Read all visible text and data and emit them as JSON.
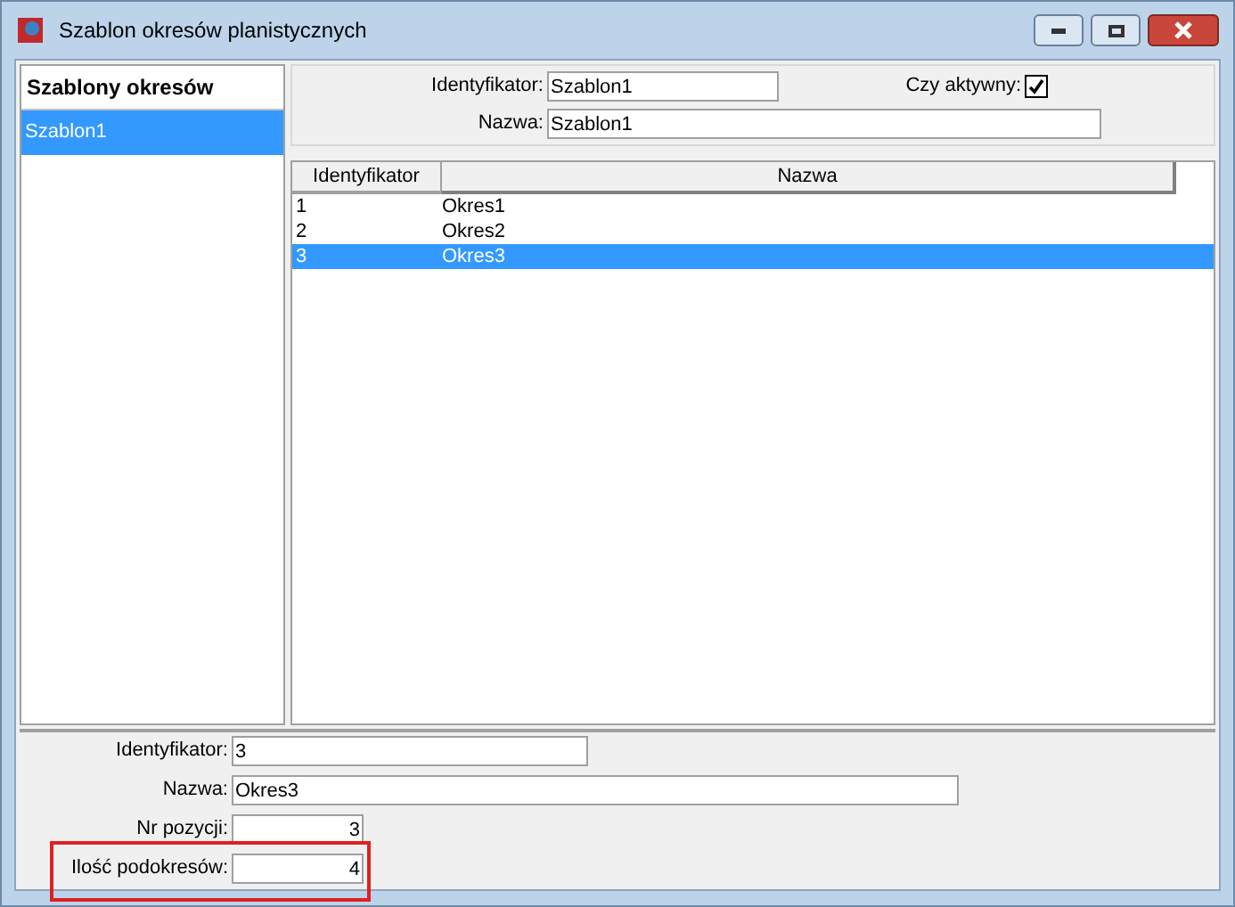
{
  "window": {
    "title": "Szablon okresów planistycznych"
  },
  "sidebar": {
    "title": "Szablony okresów",
    "items": [
      {
        "label": "Szablon1",
        "selected": true
      }
    ]
  },
  "header_form": {
    "id_label": "Identyfikator:",
    "id_value": "Szablon1",
    "active_label": "Czy aktywny:",
    "active_checked": true,
    "name_label": "Nazwa:",
    "name_value": "Szablon1"
  },
  "table": {
    "columns": [
      "Identyfikator",
      "Nazwa"
    ],
    "rows": [
      {
        "cells": [
          "1",
          "Okres1"
        ],
        "selected": false
      },
      {
        "cells": [
          "2",
          "Okres2"
        ],
        "selected": false
      },
      {
        "cells": [
          "3",
          "Okres3"
        ],
        "selected": true
      }
    ]
  },
  "detail_form": {
    "fields": [
      {
        "label": "Identyfikator:",
        "value": "3",
        "kind": "text",
        "highlighted": false
      },
      {
        "label": "Nazwa:",
        "value": "Okres3",
        "kind": "text",
        "highlighted": false
      },
      {
        "label": "Nr pozycji:",
        "value": "3",
        "kind": "number",
        "highlighted": false
      },
      {
        "label": "Ilość podokresów:",
        "value": "4",
        "kind": "number",
        "highlighted": true
      }
    ]
  }
}
